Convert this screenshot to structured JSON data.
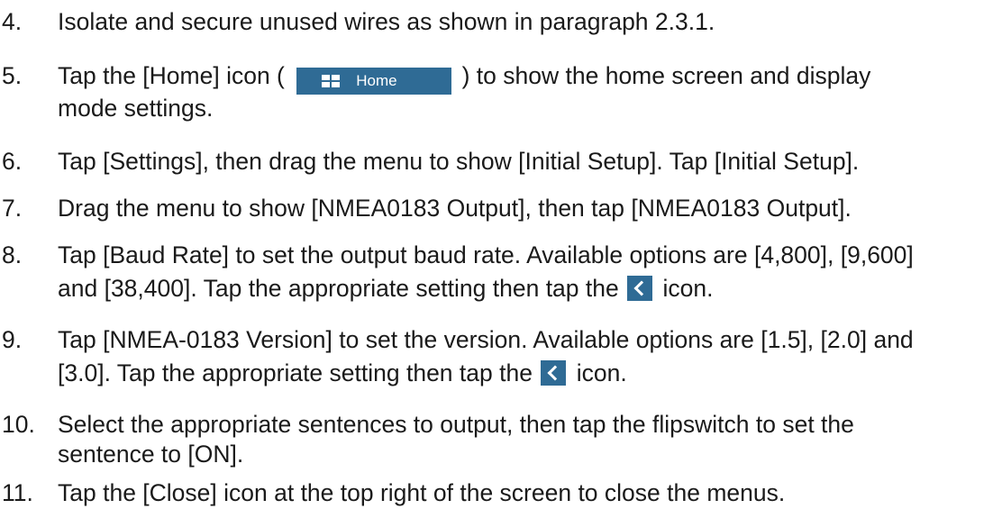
{
  "steps": [
    {
      "num": "4.",
      "lines": [
        "Isolate and secure unused wires as shown in paragraph 2.3.1."
      ]
    },
    {
      "num": "5.",
      "pre": "Tap the [Home] icon (",
      "button_label": "Home",
      "post": ") to show the home screen and display",
      "line2": "mode settings."
    },
    {
      "num": "6.",
      "lines": [
        "Tap [Settings], then drag the menu to show [Initial Setup]. Tap [Initial Setup]."
      ]
    },
    {
      "num": "7.",
      "lines": [
        "Drag the menu to show [NMEA0183 Output], then tap [NMEA0183 Output]."
      ]
    },
    {
      "num": "8.",
      "line1": "Tap [Baud Rate] to set the output baud rate. Available options are [4,800], [9,600]",
      "line2_pre": "and [38,400]. Tap the appropriate setting then tap the",
      "line2_post": "icon."
    },
    {
      "num": "9.",
      "line1": "Tap [NMEA-0183 Version] to set the version. Available options are [1.5], [2.0] and",
      "line2_pre": "[3.0]. Tap the appropriate setting then tap the",
      "line2_post": "icon."
    },
    {
      "num": "10.",
      "line1": "Select the appropriate sentences to output, then tap the flipswitch to set the",
      "line2": "sentence to [ON]."
    },
    {
      "num": "11.",
      "lines": [
        "Tap the [Close] icon at the top right of the screen to close the menus."
      ]
    }
  ],
  "icons": {
    "home": "home-grid-icon",
    "back": "back-chevron-icon"
  },
  "colors": {
    "button_bg": "#2f6b95",
    "text": "#1a1a1a"
  }
}
